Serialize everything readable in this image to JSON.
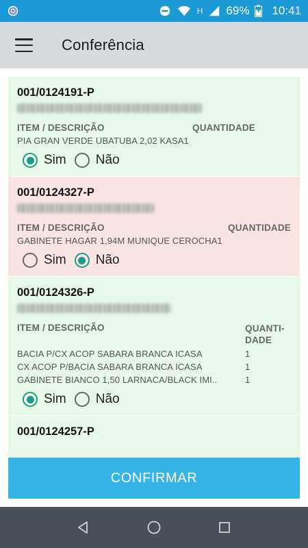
{
  "status_bar": {
    "battery": "69%",
    "time": "10:41",
    "network_label": "H"
  },
  "app_bar": {
    "title": "Conferência"
  },
  "cards": [
    {
      "id": "001/0124191-P",
      "bg": "green",
      "head_desc": "ITEM / DESCRIÇÃO",
      "head_qty": "QUANTIDADE",
      "items": [
        {
          "desc": "PIA GRAN VERDE UBATUBA 2,02 KASA1",
          "qty": ""
        }
      ],
      "option_yes": "Sim",
      "option_no": "Não",
      "selected": "yes"
    },
    {
      "id": "001/0124327-P",
      "bg": "red",
      "head_desc": "ITEM / DESCRIÇÃO",
      "head_qty": "QUANTIDADE",
      "items": [
        {
          "desc": "GABINETE HAGAR 1,94M MUNIQUE CEROCHA1",
          "qty": ""
        }
      ],
      "option_yes": "Sim",
      "option_no": "Não",
      "selected": "no"
    },
    {
      "id": "001/0124326-P",
      "bg": "green",
      "head_desc": "ITEM / DESCRIÇÃO",
      "head_qty_1": "QUANTI-",
      "head_qty_2": "DADE",
      "items": [
        {
          "desc": "BACIA P/CX ACOP SABARA BRANCA ICASA",
          "qty": "1"
        },
        {
          "desc": "CX ACOP P/BACIA SABARA BRANCA ICASA",
          "qty": "1"
        },
        {
          "desc": "GABINETE BIANCO 1,50 LARNACA/BLACK IMI..",
          "qty": "1"
        }
      ],
      "option_yes": "Sim",
      "option_no": "Não",
      "selected": "yes"
    },
    {
      "id": "001/0124257-P",
      "bg": "green"
    }
  ],
  "confirm_button": "CONFIRMAR",
  "colors": {
    "status_bar": "#1b9ad6",
    "app_bar": "#d7dbdf",
    "card_green": "#e8f8e8",
    "card_red": "#f8e4e3",
    "radio_checked": "#1f9a8a",
    "confirm_button": "#36b4e6",
    "nav_bar": "#49505a"
  },
  "icons": {
    "status_left": "app-notification-icon",
    "status_right": [
      "do-not-disturb-icon",
      "wifi-icon",
      "signal-icon",
      "battery-icon"
    ],
    "menu": "hamburger-menu-icon",
    "nav": [
      "back-icon",
      "home-icon",
      "recents-icon"
    ]
  }
}
